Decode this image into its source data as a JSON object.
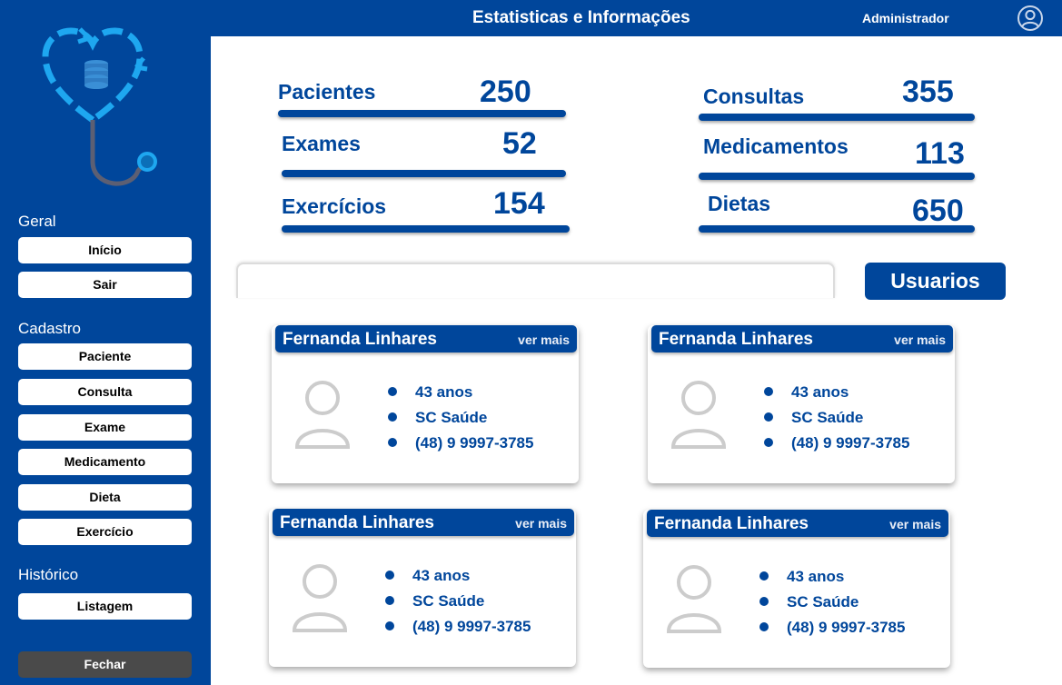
{
  "header": {
    "title": "Estatisticas e Informações",
    "admin": "Administrador",
    "icon": "user-circle-icon"
  },
  "sidebar": {
    "sections": {
      "geral": "Geral",
      "cadastro": "Cadastro",
      "historico": "Histórico"
    },
    "geral_items": [
      "Início",
      "Sair"
    ],
    "cadastro_items": [
      "Paciente",
      "Consulta",
      "Exame",
      "Medicamento",
      "Dieta",
      "Exercício"
    ],
    "historico_items": [
      "Listagem"
    ],
    "close_label": "Fechar"
  },
  "stats": {
    "pacientes": {
      "label": "Pacientes",
      "value": "250"
    },
    "exames": {
      "label": "Exames",
      "value": "52"
    },
    "exercicios": {
      "label": "Exercícios",
      "value": "154"
    },
    "consultas": {
      "label": "Consultas",
      "value": "355"
    },
    "medicamentos": {
      "label": "Medicamentos",
      "value": "113"
    },
    "dietas": {
      "label": "Dietas",
      "value": "650"
    }
  },
  "users_button": "Usuarios",
  "cards": [
    {
      "name": "Fernanda Linhares",
      "more": "ver mais",
      "age": "43 anos",
      "plan": "SC Saúde",
      "phone": "(48) 9 9997-3785"
    },
    {
      "name": "Fernanda Linhares",
      "more": "ver mais",
      "age": "43 anos",
      "plan": "SC Saúde",
      "phone": "(48) 9 9997-3785"
    },
    {
      "name": "Fernanda Linhares",
      "more": "ver mais",
      "age": "43 anos",
      "plan": "SC Saúde",
      "phone": "(48) 9 9997-3785"
    },
    {
      "name": "Fernanda Linhares",
      "more": "ver mais",
      "age": "43 anos",
      "plan": "SC Saúde",
      "phone": "(48) 9 9997-3785"
    }
  ],
  "colors": {
    "primary": "#00469b",
    "close_button": "#4a4a4a",
    "logo_accent": "#1ea7f0",
    "avatar_gray": "#cccccc"
  }
}
